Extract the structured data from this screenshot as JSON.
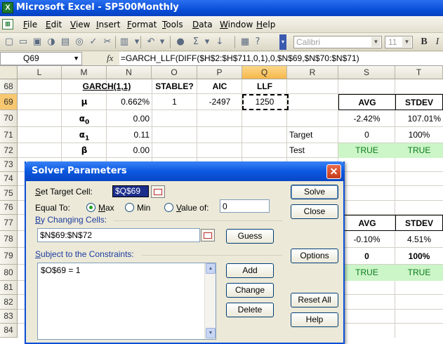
{
  "window": {
    "title": "Microsoft Excel - SP500Monthly",
    "app_icon": "excel-icon"
  },
  "menu": [
    "File",
    "Edit",
    "View",
    "Insert",
    "Format",
    "Tools",
    "Data",
    "Window",
    "Help"
  ],
  "toolbar": {
    "font": "Calibri",
    "size": "11",
    "bold": "B",
    "italic": "I"
  },
  "formula_bar": {
    "cell_ref": "Q69",
    "fx": "fx",
    "formula": "=GARCH_LLF(DIFF($H$2:$H$711,0,1),0,$N$69,$N$70:$N$71)"
  },
  "columns": [
    "L",
    "M",
    "N",
    "O",
    "P",
    "Q",
    "R",
    "S",
    "T"
  ],
  "selected_column": "Q",
  "rows": [
    "68",
    "69",
    "70",
    "71",
    "72",
    "73",
    "74",
    "75",
    "76",
    "77",
    "78",
    "79",
    "80",
    "81",
    "82",
    "83",
    "84"
  ],
  "selected_row": "69",
  "cells": {
    "m68": "GARCH(1,1)",
    "o68": "STABLE?",
    "p68": "AIC",
    "q68": "LLF",
    "m69": "μ",
    "n69": "0.662%",
    "o69": "1",
    "p69": "-2497",
    "q69": "1250",
    "s69": "AVG",
    "t69": "STDEV",
    "m70": "α",
    "m70_sub": "0",
    "n70": "0.00",
    "s70": "-2.42%",
    "t70": "107.01%",
    "m71": "α",
    "m71_sub": "1",
    "n71": "0.11",
    "r71": "Target",
    "s71": "0",
    "t71": "100%",
    "m72": "β",
    "n72": "0.00",
    "r72": "Test",
    "s72": "TRUE",
    "t72": "TRUE",
    "s77": "AVG",
    "t77": "STDEV",
    "s78": "-0.10%",
    "t78": "4.51%",
    "s79": "0",
    "t79": "100%",
    "s80": "TRUE",
    "t80": "TRUE"
  },
  "solver": {
    "title": "Solver Parameters",
    "set_target_label": "Set Target Cell:",
    "target_cell": "$Q$69",
    "equal_to_label": "Equal To:",
    "opt_max": "Max",
    "opt_min": "Min",
    "opt_value": "Value of:",
    "value_of": "0",
    "changing_label": "By Changing Cells:",
    "changing_cells": "$N$69:$N$72",
    "constraints_label": "Subject to the Constraints:",
    "constraints": [
      "$O$69 = 1"
    ],
    "buttons": {
      "solve": "Solve",
      "close": "Close",
      "guess": "Guess",
      "options": "Options",
      "add": "Add",
      "change": "Change",
      "delete": "Delete",
      "reset": "Reset All",
      "help": "Help"
    }
  }
}
